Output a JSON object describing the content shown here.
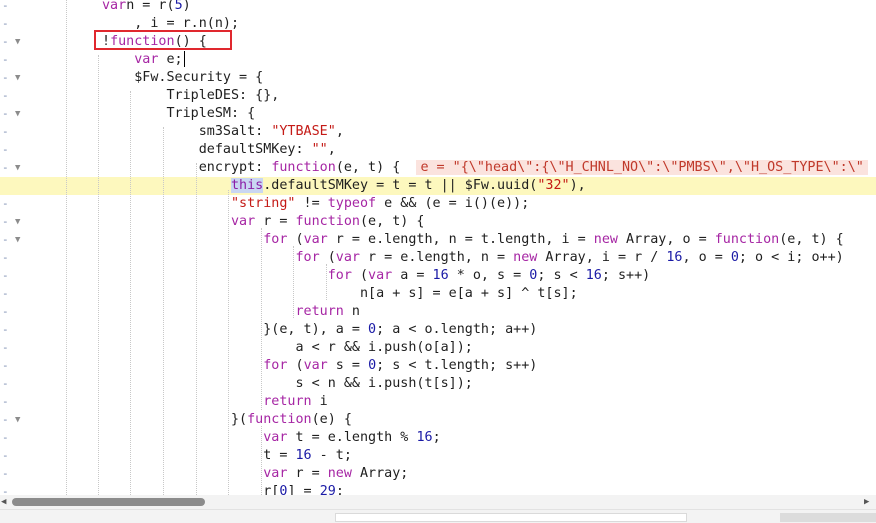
{
  "editor": {
    "lines": [
      {
        "fold": false,
        "current": false,
        "segs": [
          [
            "kw",
            "var"
          ],
          [
            "",
            "n = r("
          ],
          [
            "num",
            "5"
          ],
          [
            "",
            ")"
          ]
        ]
      },
      {
        "fold": false,
        "current": false,
        "segs": [
          [
            "",
            "    , i = r.n(n);"
          ]
        ]
      },
      {
        "fold": true,
        "current": false,
        "segs": [
          [
            "",
            "!"
          ],
          [
            "kw",
            "function"
          ],
          [
            "",
            "() {"
          ]
        ]
      },
      {
        "fold": false,
        "current": false,
        "segs": [
          [
            "",
            "    "
          ],
          [
            "kw",
            "var"
          ],
          [
            "",
            " e;"
          ]
        ]
      },
      {
        "fold": true,
        "current": false,
        "segs": [
          [
            "",
            "    $Fw.Security = {"
          ]
        ]
      },
      {
        "fold": false,
        "current": false,
        "segs": [
          [
            "",
            "        TripleDES: {},"
          ]
        ]
      },
      {
        "fold": true,
        "current": false,
        "segs": [
          [
            "",
            "        TripleSM: {"
          ]
        ]
      },
      {
        "fold": false,
        "current": false,
        "segs": [
          [
            "",
            "            sm3Salt: "
          ],
          [
            "str",
            "\"YTBASE\""
          ],
          [
            "",
            ","
          ]
        ]
      },
      {
        "fold": false,
        "current": false,
        "segs": [
          [
            "",
            "            defaultSMKey: "
          ],
          [
            "str",
            "\"\""
          ],
          [
            "",
            ","
          ]
        ]
      },
      {
        "fold": true,
        "current": false,
        "segs": [
          [
            "",
            "            encrypt: "
          ],
          [
            "kw",
            "function"
          ],
          [
            "",
            "(e, t) {  "
          ],
          [
            "tip",
            "e = \"{\\\"head\\\":{\\\"H_CHNL_NO\\\":\\\"PMBS\\\",\\\"H_OS_TYPE\\\":\\\""
          ]
        ]
      },
      {
        "fold": false,
        "current": true,
        "segs": [
          [
            "",
            "                "
          ],
          [
            "thisk",
            "this"
          ],
          [
            "",
            ".defaultSMKey = t = t || $Fw.uuid("
          ],
          [
            "str",
            "\"32\""
          ],
          [
            "",
            "),"
          ]
        ]
      },
      {
        "fold": false,
        "current": false,
        "segs": [
          [
            "",
            "                "
          ],
          [
            "str",
            "\"string\""
          ],
          [
            "",
            " != "
          ],
          [
            "kw",
            "typeof"
          ],
          [
            "",
            " e && (e = i()(e));"
          ]
        ]
      },
      {
        "fold": true,
        "current": false,
        "segs": [
          [
            "",
            "                "
          ],
          [
            "kw",
            "var"
          ],
          [
            "",
            " r = "
          ],
          [
            "kw",
            "function"
          ],
          [
            "",
            "(e, t) {"
          ]
        ]
      },
      {
        "fold": true,
        "current": false,
        "segs": [
          [
            "",
            "                    "
          ],
          [
            "kw",
            "for"
          ],
          [
            "",
            " ("
          ],
          [
            "kw",
            "var"
          ],
          [
            "",
            " r = e.length, n = t.length, i = "
          ],
          [
            "kw",
            "new"
          ],
          [
            "",
            " Array, o = "
          ],
          [
            "kw",
            "function"
          ],
          [
            "",
            "(e, t) {"
          ]
        ]
      },
      {
        "fold": false,
        "current": false,
        "segs": [
          [
            "",
            "                        "
          ],
          [
            "kw",
            "for"
          ],
          [
            "",
            " ("
          ],
          [
            "kw",
            "var"
          ],
          [
            "",
            " r = e.length, n = "
          ],
          [
            "kw",
            "new"
          ],
          [
            "",
            " Array, i = r / "
          ],
          [
            "num",
            "16"
          ],
          [
            "",
            ", o = "
          ],
          [
            "num",
            "0"
          ],
          [
            "",
            "; o < i; o++)"
          ]
        ]
      },
      {
        "fold": false,
        "current": false,
        "segs": [
          [
            "",
            "                            "
          ],
          [
            "kw",
            "for"
          ],
          [
            "",
            " ("
          ],
          [
            "kw",
            "var"
          ],
          [
            "",
            " a = "
          ],
          [
            "num",
            "16"
          ],
          [
            "",
            " * o, s = "
          ],
          [
            "num",
            "0"
          ],
          [
            "",
            "; s < "
          ],
          [
            "num",
            "16"
          ],
          [
            "",
            "; s++)"
          ]
        ]
      },
      {
        "fold": false,
        "current": false,
        "segs": [
          [
            "",
            "                                n[a + s] = e[a + s] ^ t[s];"
          ]
        ]
      },
      {
        "fold": false,
        "current": false,
        "segs": [
          [
            "",
            "                        "
          ],
          [
            "kw",
            "return"
          ],
          [
            "",
            " n"
          ]
        ]
      },
      {
        "fold": false,
        "current": false,
        "segs": [
          [
            "",
            "                    }(e, t), a = "
          ],
          [
            "num",
            "0"
          ],
          [
            "",
            "; a < o.length; a++)"
          ]
        ]
      },
      {
        "fold": false,
        "current": false,
        "segs": [
          [
            "",
            "                        a < r && i.push(o[a]);"
          ]
        ]
      },
      {
        "fold": false,
        "current": false,
        "segs": [
          [
            "",
            "                    "
          ],
          [
            "kw",
            "for"
          ],
          [
            "",
            " ("
          ],
          [
            "kw",
            "var"
          ],
          [
            "",
            " s = "
          ],
          [
            "num",
            "0"
          ],
          [
            "",
            "; s < t.length; s++)"
          ]
        ]
      },
      {
        "fold": false,
        "current": false,
        "segs": [
          [
            "",
            "                        s < n && i.push(t[s]);"
          ]
        ]
      },
      {
        "fold": false,
        "current": false,
        "segs": [
          [
            "",
            "                    "
          ],
          [
            "kw",
            "return"
          ],
          [
            "",
            " i"
          ]
        ]
      },
      {
        "fold": true,
        "current": false,
        "segs": [
          [
            "",
            "                }("
          ],
          [
            "kw",
            "function"
          ],
          [
            "",
            "(e) {"
          ]
        ]
      },
      {
        "fold": false,
        "current": false,
        "segs": [
          [
            "",
            "                    "
          ],
          [
            "kw",
            "var"
          ],
          [
            "",
            " t = e.length % "
          ],
          [
            "num",
            "16"
          ],
          [
            "",
            ";"
          ]
        ]
      },
      {
        "fold": false,
        "current": false,
        "segs": [
          [
            "",
            "                    t = "
          ],
          [
            "num",
            "16"
          ],
          [
            "",
            " - t;"
          ]
        ]
      },
      {
        "fold": false,
        "current": false,
        "segs": [
          [
            "",
            "                    "
          ],
          [
            "kw",
            "var"
          ],
          [
            "",
            " r = "
          ],
          [
            "kw",
            "new"
          ],
          [
            "",
            " Array;"
          ]
        ]
      },
      {
        "fold": false,
        "current": false,
        "segs": [
          [
            "",
            "                    r["
          ],
          [
            "num",
            "0"
          ],
          [
            "",
            "] = "
          ],
          [
            "num",
            "29"
          ],
          [
            "",
            ";"
          ]
        ]
      }
    ]
  },
  "icons": {
    "fold": "fold-arrow-icon",
    "scroll_left": "scroll-left-arrow-icon",
    "scroll_right": "scroll-right-arrow-icon"
  },
  "glyphs": {
    "gutter_dash": "-",
    "fold_arrow": "▼",
    "scroll_left": "◀",
    "scroll_right": "▶"
  },
  "colors": {
    "keyword": "#a626a4",
    "string": "#c41a16",
    "number": "#1a1aa6",
    "current_line": "#fdf8be",
    "inline_value_bg": "#fbe3de",
    "highlight_box": "#e0282e"
  }
}
